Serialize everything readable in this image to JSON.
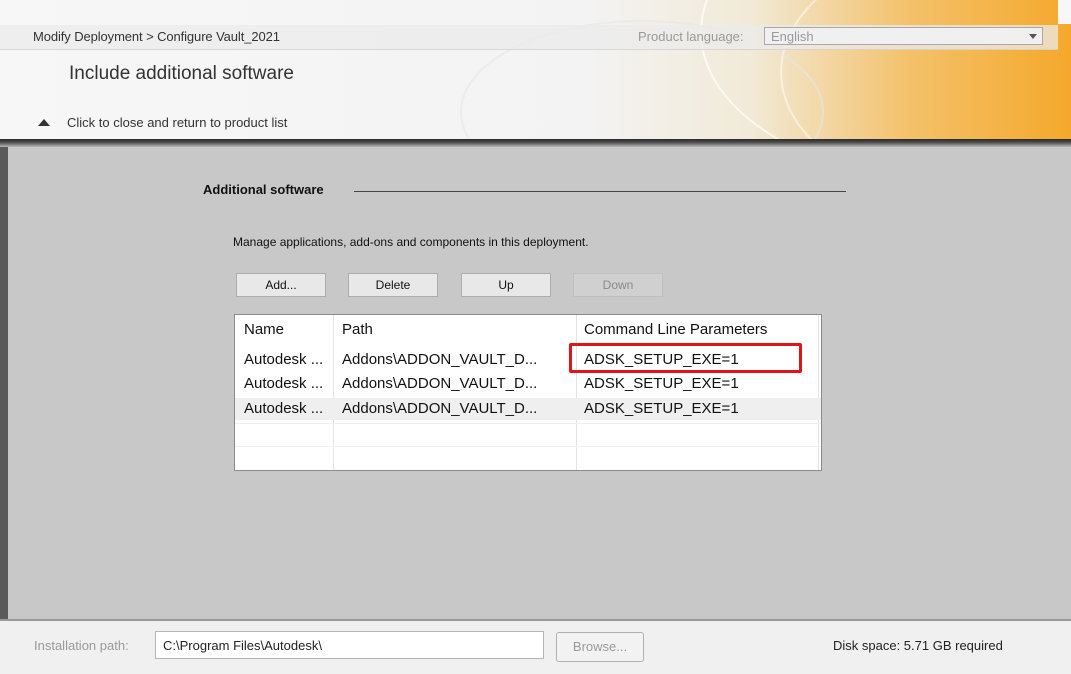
{
  "header": {
    "breadcrumb": "Modify Deployment > Configure Vault_2021",
    "language_label": "Product language:",
    "language_value": "English",
    "title": "Include additional software",
    "close_link": "Click to close and return to product list"
  },
  "section": {
    "title": "Additional software",
    "description": "Manage applications, add-ons and components in this deployment."
  },
  "buttons": {
    "add": "Add...",
    "delete": "Delete",
    "up": "Up",
    "down": "Down"
  },
  "table": {
    "columns": [
      "Name",
      "Path",
      "Command Line Parameters"
    ],
    "rows": [
      [
        "Autodesk ...",
        "Addons\\ADDON_VAULT_D...",
        "ADSK_SETUP_EXE=1"
      ],
      [
        "Autodesk ...",
        "Addons\\ADDON_VAULT_D...",
        "ADSK_SETUP_EXE=1"
      ],
      [
        "Autodesk ...",
        "Addons\\ADDON_VAULT_D...",
        "ADSK_SETUP_EXE=1"
      ]
    ]
  },
  "footer": {
    "install_label": "Installation path:",
    "install_path": "C:\\Program Files\\Autodesk\\",
    "browse": "Browse...",
    "disk_space": "Disk space:  5.71 GB required"
  },
  "colors": {
    "highlight": "#e0141b",
    "header_accent": "#f5a82b"
  }
}
